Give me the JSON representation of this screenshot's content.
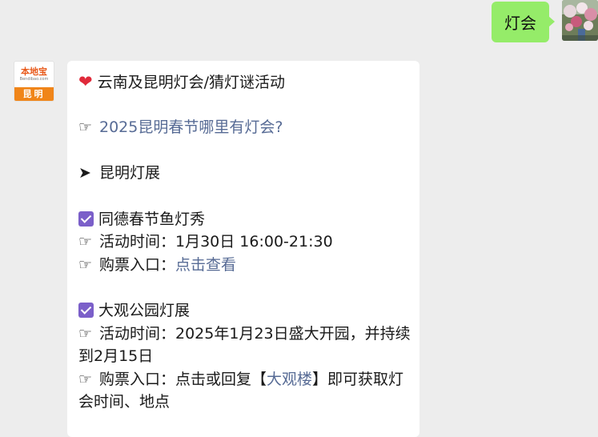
{
  "sent_message": {
    "text": "灯会"
  },
  "account": {
    "brand": "本地宝",
    "url": "Bendibao.com",
    "city": "昆明"
  },
  "message": {
    "line1": {
      "icon": "❤",
      "text": "云南及昆明灯会/猜灯谜活动"
    },
    "line2": {
      "icon": "☞",
      "link": "2025昆明春节哪里有灯会?"
    },
    "line3": {
      "icon": "➤",
      "text": "昆明灯展"
    },
    "event1": {
      "title": "同德春节鱼灯秀",
      "time_icon": "☞",
      "time": "活动时间：1月30日 16:00-21:30",
      "ticket_icon": "☞",
      "ticket_label": "购票入口：",
      "ticket_link": "点击查看"
    },
    "event2": {
      "title": "大观公园灯展",
      "time_icon": "☞",
      "time": "活动时间：2025年1月23日盛大开园，并持续到2月15日",
      "ticket_icon": "☞",
      "ticket_prefix": "购票入口：点击或回复【",
      "ticket_link": "大观楼",
      "ticket_suffix": "】即可获取灯会时间、地点"
    }
  }
}
